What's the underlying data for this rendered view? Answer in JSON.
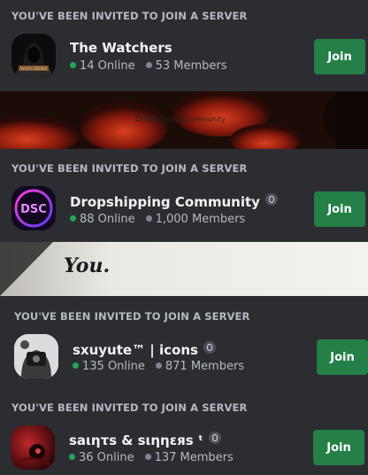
{
  "invites": [
    {
      "header": "YOU'VE BEEN INVITED TO JOIN A SERVER",
      "name": "The Watchers",
      "online": "14 Online",
      "members": "53 Members",
      "join_label": "Join",
      "icon": "watchers-server-icon",
      "icon_text": "WATCHERS"
    },
    {
      "header": "YOU'VE BEEN INVITED TO JOIN A SERVER",
      "name": "Dropshipping Community",
      "online": "88 Online",
      "members": "1,000 Members",
      "join_label": "Join",
      "icon": "dsc-server-icon",
      "icon_text": "DSC"
    },
    {
      "header": "YOU'VE BEEN INVITED TO JOIN A SERVER",
      "name": "sxuyute™ | icons",
      "online": "135 Online",
      "members": "871 Members",
      "join_label": "Join",
      "icon": "sxuyute-server-icon"
    },
    {
      "header": "YOU'VE BEEN INVITED TO JOIN A SERVER",
      "name": "saιητs & sιηηεяs ᵗ",
      "online": "36 Online",
      "members": "137 Members",
      "join_label": "Join",
      "icon": "saints-server-icon"
    }
  ],
  "banners": [
    {
      "text": "Dropshipping Community"
    },
    {
      "text": "You."
    }
  ],
  "colors": {
    "background": "#2b2d31",
    "join_button": "#248046",
    "online_dot": "#23a55a",
    "members_dot": "#80848e"
  }
}
